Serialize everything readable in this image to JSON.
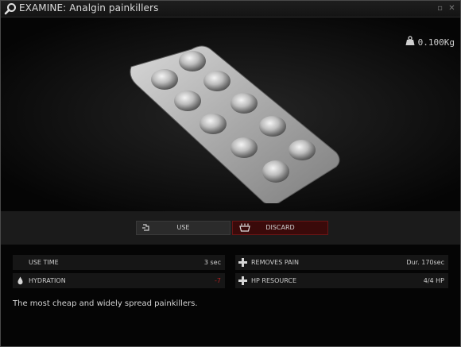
{
  "window": {
    "title": "EXAMINE: Analgin painkillers",
    "minimize": "▫",
    "close": "✕"
  },
  "item": {
    "weight": "0.100Kg",
    "description": "The most cheap and widely spread painkillers."
  },
  "actions": {
    "use_label": "USE",
    "discard_label": "DISCARD"
  },
  "stats": {
    "use_time": {
      "label": "USE TIME",
      "value": "3 sec"
    },
    "removes_pain": {
      "label": "REMOVES PAIN",
      "value": "Dur. 170sec"
    },
    "hydration": {
      "label": "HYDRATION",
      "value": "-7"
    },
    "hp_resource": {
      "label": "HP RESOURCE",
      "value": "4/4 HP"
    }
  },
  "colors": {
    "discard_bg": "#3a0a0a",
    "hydration_value": "#b02020"
  },
  "icons": {
    "title": "magnifier-icon",
    "weight": "weight-icon",
    "use": "use-icon",
    "discard": "discard-icon",
    "hydration": "water-drop-icon",
    "removes_pain": "medical-cross-icon",
    "hp_resource": "medical-cross-icon"
  }
}
